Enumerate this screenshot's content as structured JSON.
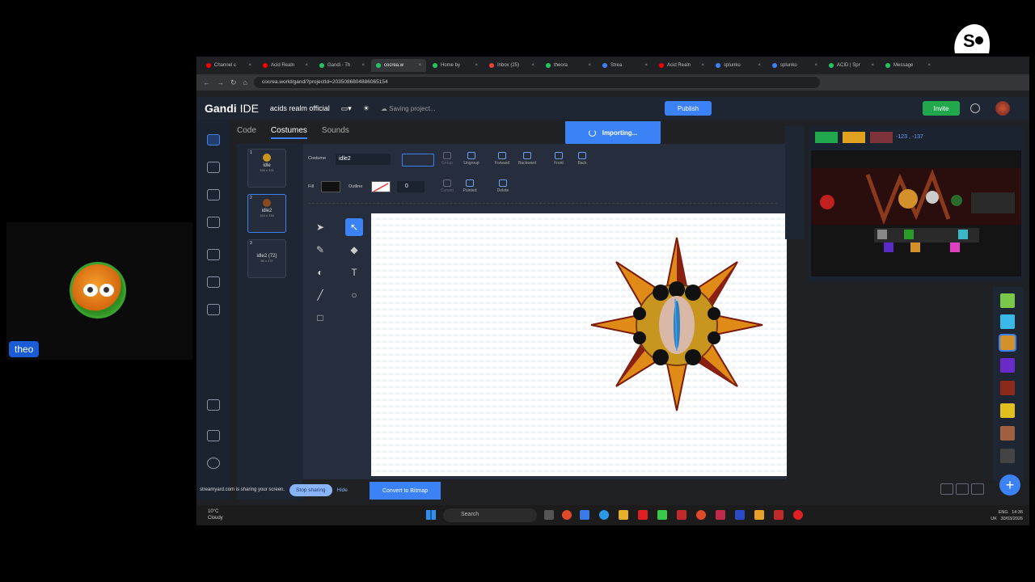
{
  "overlay": {
    "participant_name": "theo",
    "brand": "streamyard"
  },
  "browser": {
    "tabs": [
      {
        "label": "Channel c",
        "color": "#ff0000"
      },
      {
        "label": "Acid Realn",
        "color": "#ff0000"
      },
      {
        "label": "Gandi - Th",
        "color": "#22c55e"
      },
      {
        "label": "cocrea.w",
        "color": "#22c55e"
      },
      {
        "label": "Home by",
        "color": "#22c55e"
      },
      {
        "label": "Inbox (25)",
        "color": "#ea4335"
      },
      {
        "label": "theora",
        "color": "#22c55e"
      },
      {
        "label": "Strea",
        "color": "#3b82f6"
      },
      {
        "label": "Acid Realn",
        "color": "#ff0000"
      },
      {
        "label": "splunko",
        "color": "#3b82f6"
      },
      {
        "label": "splunko",
        "color": "#3b82f6"
      },
      {
        "label": "ACID | Spr",
        "color": "#22c55e"
      },
      {
        "label": "Message",
        "color": "#22c55e"
      }
    ],
    "url": "cocrea.world/gandi?projectId=2035086804886065154"
  },
  "ide": {
    "brand_bold": "Gandi",
    "brand_light": "IDE",
    "project_name": "acids realm official",
    "saving_status": "Saving project...",
    "publish_label": "Publish",
    "invite_label": "Invite",
    "importing_label": "Importing...",
    "tabs": [
      "Code",
      "Costumes",
      "Sounds"
    ],
    "costumes": [
      {
        "num": "1",
        "name": "idle",
        "size": "166 x 321"
      },
      {
        "num": "2",
        "name": "idle2",
        "size": "164 x 318"
      },
      {
        "num": "3",
        "name": "idle2 (72)",
        "size": "86 x 272"
      }
    ],
    "toolbar": {
      "costume_label": "Costume",
      "costume_name": "idle2",
      "fill_label": "Fill",
      "outline_label": "Outline",
      "outline_width": "0",
      "group": "Group",
      "ungroup": "Ungroup",
      "forward": "Forward",
      "backward": "Backward",
      "front": "Front",
      "back": "Back",
      "curved": "Curved",
      "pointed": "Pointed",
      "delete": "Delete"
    },
    "convert_label": "Convert to Bitmap",
    "stage_coords": "-123 , -137"
  },
  "share": {
    "notice": "streamyard.com is sharing your screen.",
    "stop_label": "Stop sharing",
    "hide_label": "Hide"
  },
  "taskbar": {
    "temp": "10°C",
    "weather": "Cloudy",
    "search_placeholder": "Search",
    "lang": "ENG",
    "region": "UK",
    "time": "14:36",
    "date": "30/03/2026"
  }
}
